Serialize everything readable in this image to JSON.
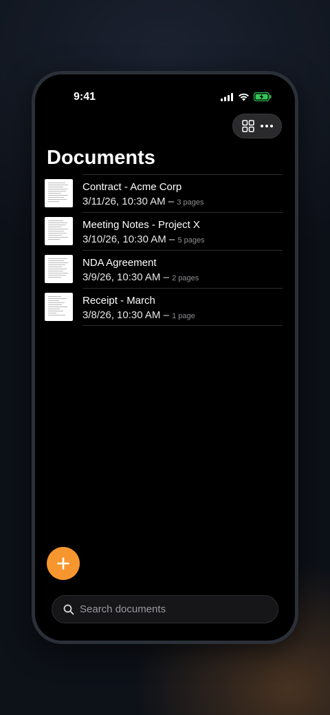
{
  "status_bar": {
    "time": "9:41"
  },
  "toolbar": {
    "grid_icon": "grid-icon",
    "more_icon": "more-icon"
  },
  "page": {
    "title": "Documents"
  },
  "documents": [
    {
      "name": "Contract - Acme Corp",
      "date": "3/11/26, 10:30 AM –",
      "pages": "3 pages"
    },
    {
      "name": "Meeting Notes - Project X",
      "date": "3/10/26, 10:30 AM –",
      "pages": "5 pages"
    },
    {
      "name": "NDA Agreement",
      "date": "3/9/26, 10:30 AM –",
      "pages": "2 pages"
    },
    {
      "name": "Receipt - March",
      "date": "3/8/26, 10:30 AM –",
      "pages": "1 page"
    }
  ],
  "fab": {
    "icon": "plus-icon"
  },
  "search": {
    "placeholder": "Search documents",
    "value": ""
  },
  "colors": {
    "accent": "#f7962e",
    "battery": "#34c759",
    "background": "#000000"
  }
}
